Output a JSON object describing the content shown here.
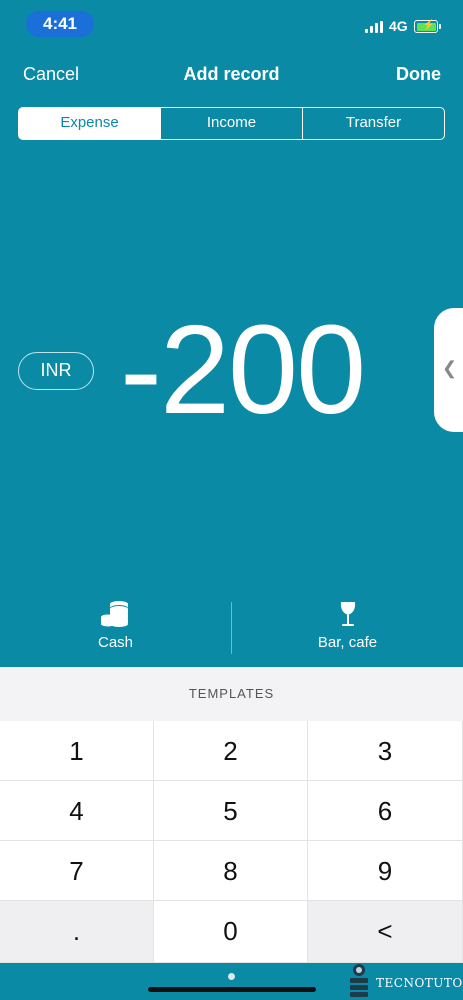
{
  "status_bar": {
    "time": "4:41",
    "network": "4G",
    "battery_charging": true,
    "colors": {
      "time_pill": "#1a6fd8",
      "battery": "#5ce35a"
    }
  },
  "nav": {
    "cancel": "Cancel",
    "title": "Add record",
    "done": "Done"
  },
  "tabs": [
    {
      "label": "Expense",
      "active": true
    },
    {
      "label": "Income",
      "active": false
    },
    {
      "label": "Transfer",
      "active": false
    }
  ],
  "amount": {
    "currency": "INR",
    "value": "-200"
  },
  "side_tab_icon": "chevron-left-icon",
  "account": {
    "label": "Cash",
    "icon": "coins-icon"
  },
  "category": {
    "label": "Bar, cafe",
    "icon": "wine-glass-icon"
  },
  "templates_label": "TEMPLATES",
  "keypad": [
    "1",
    "2",
    "3",
    "4",
    "5",
    "6",
    "7",
    "8",
    "9",
    ".",
    "0",
    "<"
  ],
  "watermark": "TECNOTUTO",
  "colors": {
    "accent": "#0a8aa5",
    "keypad_bg": "#f3f3f5"
  }
}
